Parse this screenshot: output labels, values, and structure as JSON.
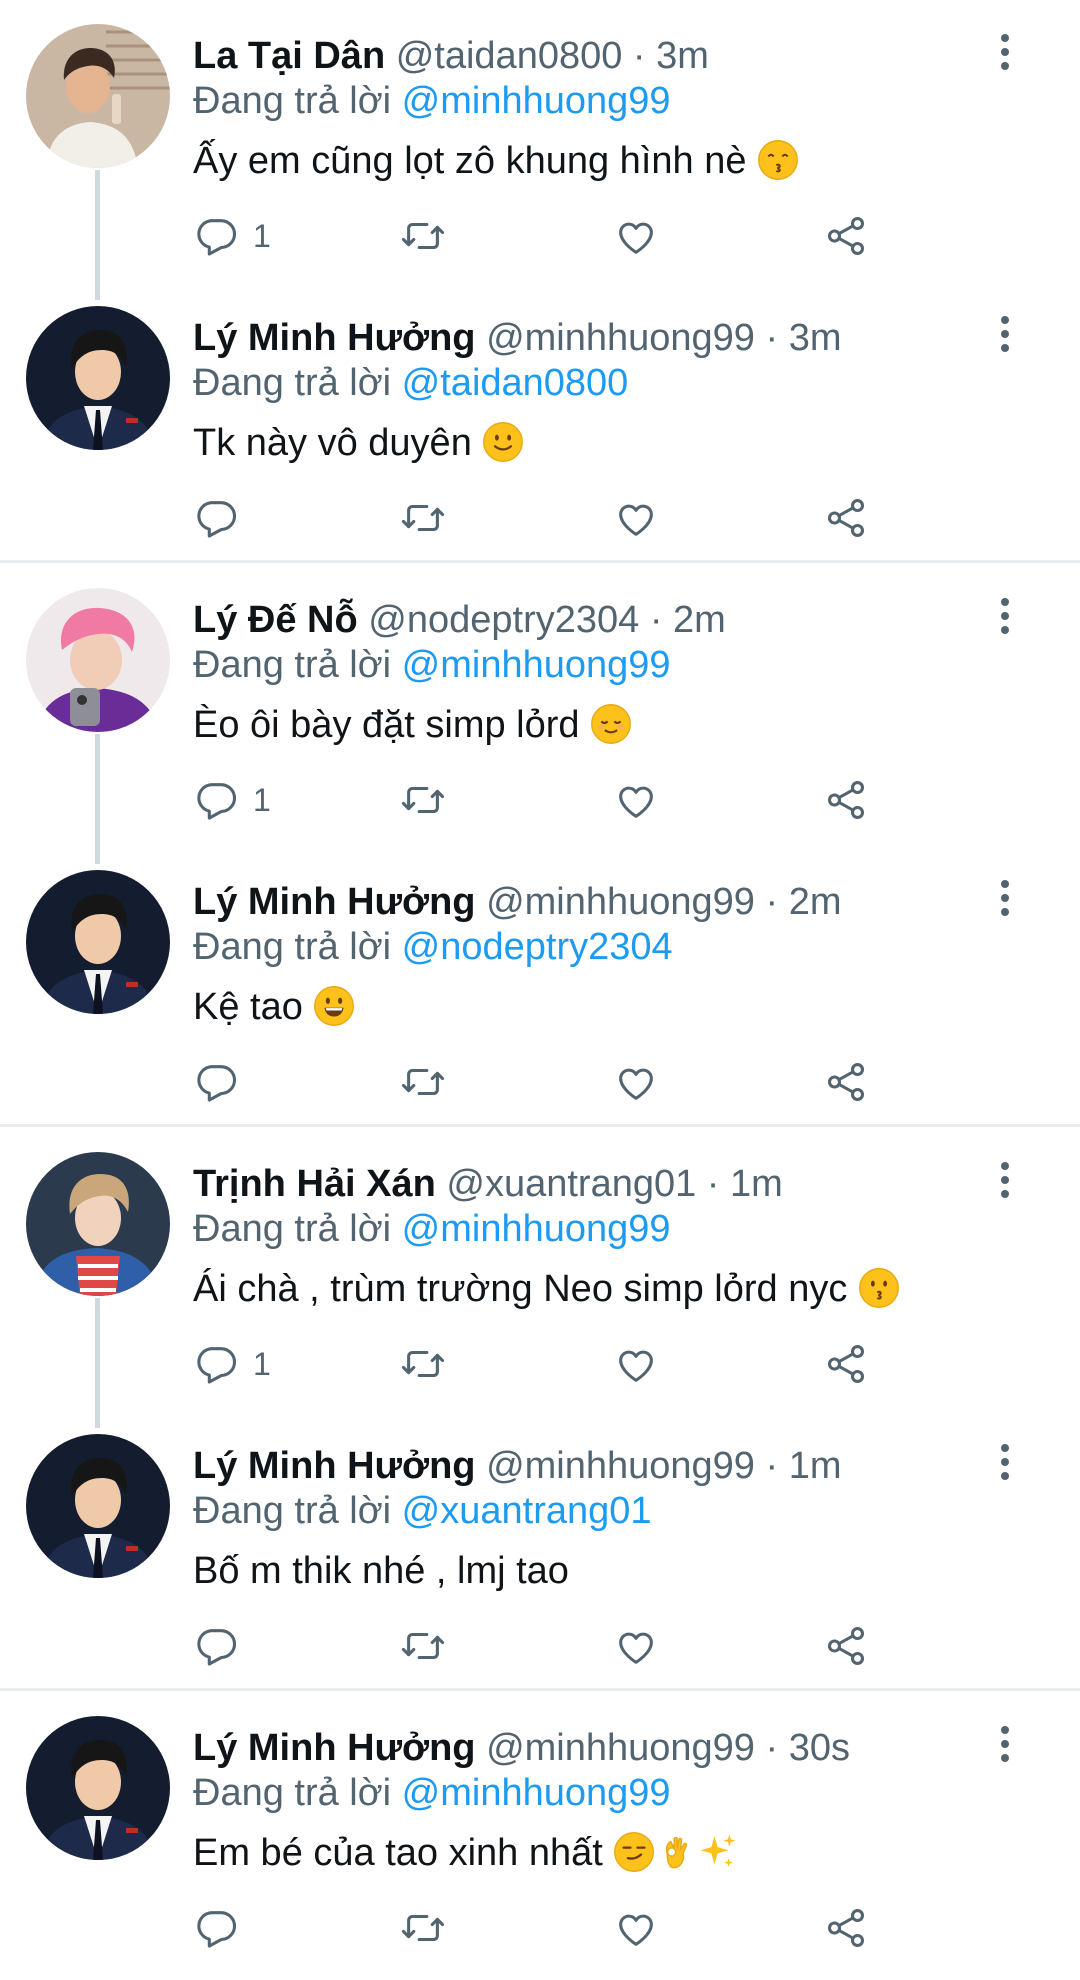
{
  "tweets": [
    {
      "name": "La Tại Dân",
      "handle": "@taidan0800",
      "time": "3m",
      "reply_label": "Đang trả lời",
      "reply_to": "@minhhuong99",
      "text": "Ấy em cũng lọt zô khung hình nè",
      "emojis": [
        "kissing-smiling-eyes"
      ],
      "reply_count": "1",
      "avatar": "avatar-la-tai-dan"
    },
    {
      "name": "Lý Minh Hưởng",
      "handle": "@minhhuong99",
      "time": "3m",
      "reply_label": "Đang trả lời",
      "reply_to": "@taidan0800",
      "text": "Tk này vô duyên",
      "emojis": [
        "slightly-smiling"
      ],
      "reply_count": "",
      "avatar": "avatar-ly-minh-huong"
    },
    {
      "name": "Lý Đế Nỗ",
      "handle": "@nodeptry2304",
      "time": "2m",
      "reply_label": "Đang trả lời",
      "reply_to": "@minhhuong99",
      "text": "Èo ôi bày đặt simp lỏrd",
      "emojis": [
        "relieved"
      ],
      "reply_count": "1",
      "avatar": "avatar-ly-de-no"
    },
    {
      "name": "Lý Minh Hưởng",
      "handle": "@minhhuong99",
      "time": "2m",
      "reply_label": "Đang trả lời",
      "reply_to": "@nodeptry2304",
      "text": "Kệ tao",
      "emojis": [
        "grinning"
      ],
      "reply_count": "",
      "avatar": "avatar-ly-minh-huong"
    },
    {
      "name": "Trịnh Hải Xán",
      "handle": "@xuantrang01",
      "time": "1m",
      "reply_label": "Đang trả lời",
      "reply_to": "@minhhuong99",
      "text": "Ái chà , trùm trường Neo simp lỏrd nyc",
      "emojis": [
        "kissing"
      ],
      "reply_count": "1",
      "avatar": "avatar-trinh-hai-xan"
    },
    {
      "name": "Lý Minh Hưởng",
      "handle": "@minhhuong99",
      "time": "1m",
      "reply_label": "Đang trả lời",
      "reply_to": "@xuantrang01",
      "text": "Bố m thik nhé , lmj tao",
      "emojis": [],
      "reply_count": "",
      "avatar": "avatar-ly-minh-huong"
    },
    {
      "name": "Lý Minh Hưởng",
      "handle": "@minhhuong99",
      "time": "30s",
      "reply_label": "Đang trả lời",
      "reply_to": "@minhhuong99",
      "text": "Em bé của tao xinh nhất ",
      "emojis": [
        "smirking",
        "ok-hand",
        "sparkles"
      ],
      "reply_count": "",
      "avatar": "avatar-ly-minh-huong"
    }
  ],
  "icons": {
    "reply": "reply-icon",
    "retweet": "retweet-icon",
    "like": "like-icon",
    "share": "share-icon",
    "more": "more-icon"
  },
  "colors": {
    "mention": "#1d9bf0",
    "secondary_text": "#536471",
    "icon": "#536471",
    "divider": "#e6ecf0",
    "thread_line": "#cfd9de"
  }
}
